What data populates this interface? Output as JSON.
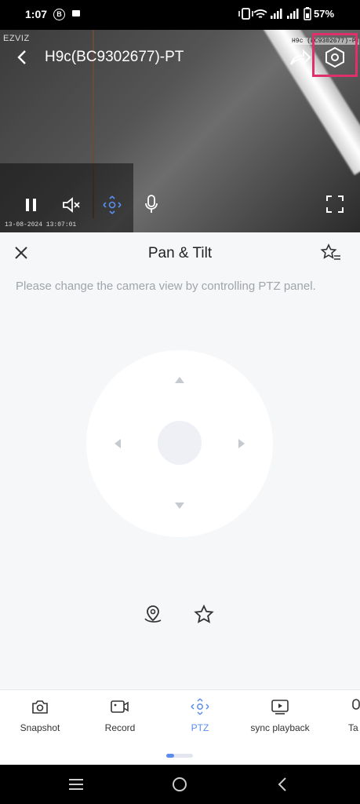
{
  "status_bar": {
    "time": "1:07",
    "b_badge": "B",
    "battery": "57%"
  },
  "video": {
    "brand": "EZVIZ",
    "title": "H9c(BC9302677)-PT",
    "cam_code": "H9c (BC9302677)-PT",
    "timestamp": "13-08-2024 13:07:01"
  },
  "panel": {
    "title": "Pan & Tilt",
    "hint": "Please change the camera view by controlling PTZ panel."
  },
  "toolbar": {
    "items": [
      {
        "label": "Snapshot",
        "icon": "camera-icon"
      },
      {
        "label": "Record",
        "icon": "video-record-icon"
      },
      {
        "label": "PTZ",
        "icon": "ptz-icon",
        "active": true
      },
      {
        "label": "sync playback",
        "icon": "sync-playback-icon"
      },
      {
        "label": "Ta",
        "icon": "talk-icon"
      }
    ]
  },
  "colors": {
    "accent": "#5b8def",
    "highlight": "#e0306b"
  }
}
